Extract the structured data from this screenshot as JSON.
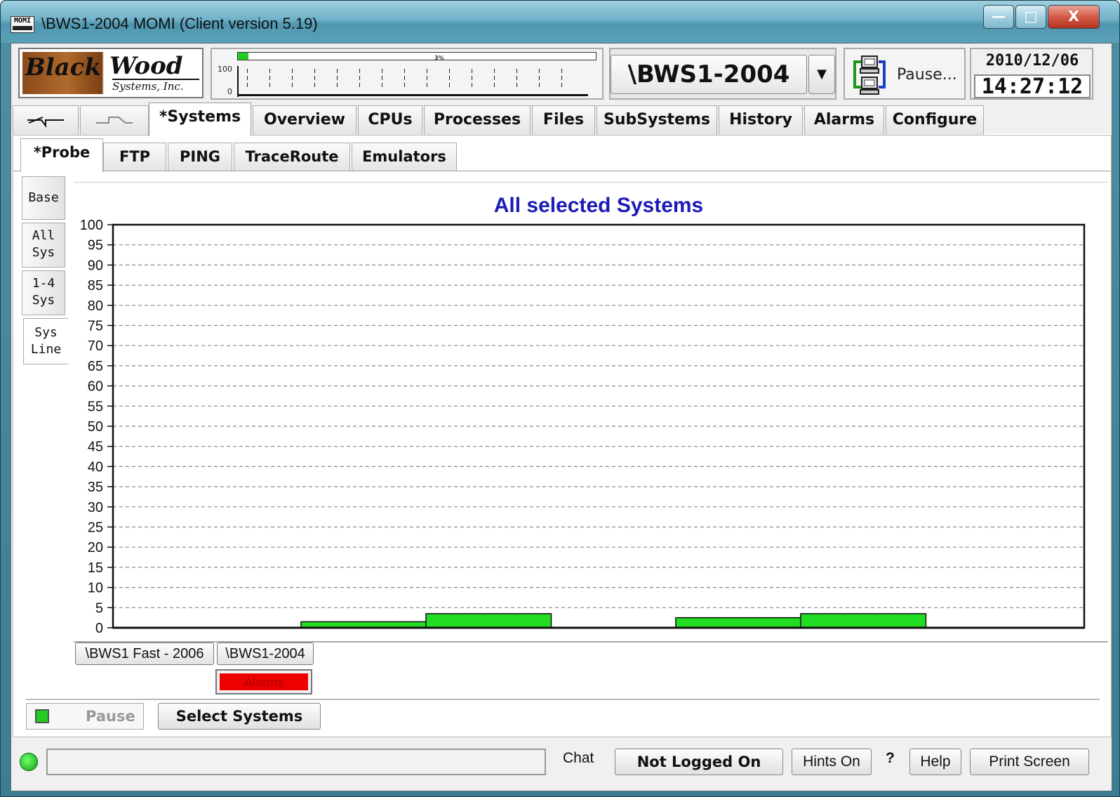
{
  "window": {
    "title": "\\BWS1-2004 MOMI (Client version 5.19)",
    "app_icon_text": "MOMI",
    "minimize": "—",
    "maximize": "□",
    "close": "X"
  },
  "header": {
    "logo": {
      "line1": "Black",
      "line2": "Wood",
      "line3": "Systems, Inc."
    },
    "mini_chart": {
      "percent_label": "3%",
      "percent": 3,
      "top_label": "100",
      "bottom_label": "0"
    },
    "system_name": "\\BWS1-2004",
    "dropdown_icon": "caret-down-icon",
    "pause_label": "Pause...",
    "date": "2010/12/06",
    "time": "14:27:12"
  },
  "main_tabs": [
    {
      "label": "",
      "icon": "pulse-down-icon"
    },
    {
      "label": "",
      "icon": "pulse-up-icon"
    },
    {
      "label": "*Systems",
      "active": true
    },
    {
      "label": "Overview"
    },
    {
      "label": "CPUs"
    },
    {
      "label": "Processes"
    },
    {
      "label": "Files"
    },
    {
      "label": "SubSystems"
    },
    {
      "label": "History"
    },
    {
      "label": "Alarms"
    },
    {
      "label": "Configure"
    }
  ],
  "sub_tabs": [
    {
      "label": "*Probe",
      "active": true
    },
    {
      "label": "FTP"
    },
    {
      "label": "PING"
    },
    {
      "label": "TraceRoute"
    },
    {
      "label": "Emulators"
    }
  ],
  "side_tabs": [
    {
      "line1": "Base",
      "line2": ""
    },
    {
      "line1": "All",
      "line2": "Sys"
    },
    {
      "line1": "1-4",
      "line2": "Sys"
    },
    {
      "line1": "Sys",
      "line2": "Line",
      "active": true
    }
  ],
  "chart_data": {
    "type": "bar",
    "title": "All selected Systems",
    "ylim": [
      0,
      100
    ],
    "yticks": [
      0,
      5,
      10,
      15,
      20,
      25,
      30,
      35,
      40,
      45,
      50,
      55,
      60,
      65,
      70,
      75,
      80,
      85,
      90,
      95,
      100
    ],
    "grid": true,
    "bar_color": "#22dd22",
    "categories": [
      "",
      "",
      "",
      "",
      "",
      "",
      ""
    ],
    "values": [
      0,
      1.5,
      3.5,
      0,
      2.5,
      3.5,
      0
    ]
  },
  "legend": {
    "system1": "\\BWS1 Fast - 2006",
    "system2": "\\BWS1-2004",
    "alarms": "Alarms",
    "alarm_color": "#ee0000"
  },
  "controls": {
    "pause": "Pause",
    "select_systems": "Select Systems"
  },
  "statusbar": {
    "status_text": "",
    "chat": "Chat",
    "logged": "Not Logged On",
    "hints": "Hints On",
    "question": "?",
    "help": "Help",
    "print": "Print Screen"
  }
}
